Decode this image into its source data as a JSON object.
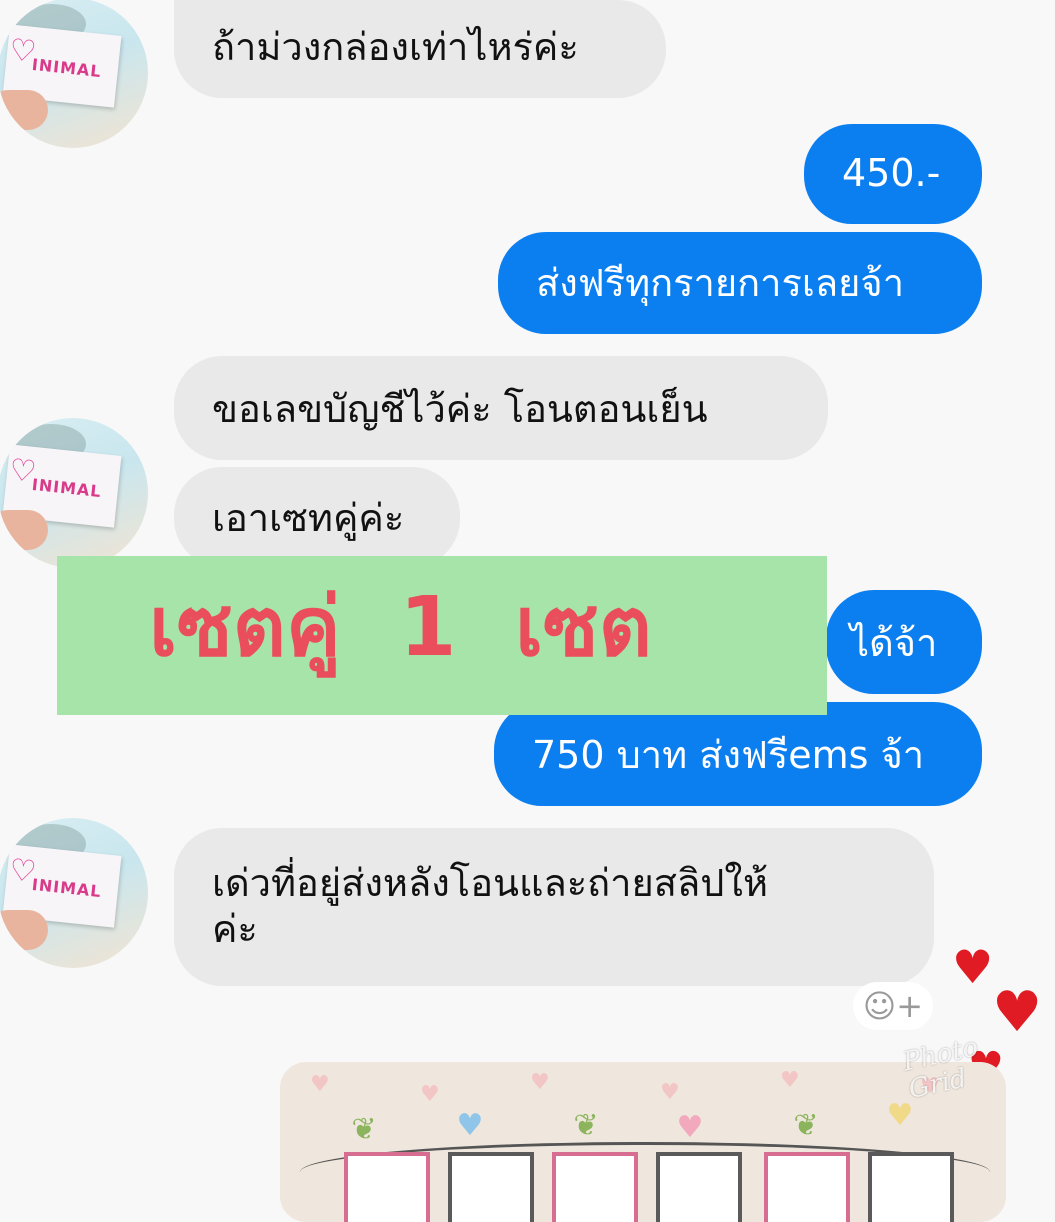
{
  "messages": [
    {
      "text": "ถ้าม่วงกล่องเท่าไหร่ค่ะ"
    },
    {
      "text": "450.-"
    },
    {
      "text": "ส่งฟรีทุกรายการเลยจ้า"
    },
    {
      "text": "ขอเลขบัญชีไว้ค่ะ โอนตอนเย็น"
    },
    {
      "text": "เอาเซทคู่ค่ะ"
    },
    {
      "text": "ได้จ้า"
    },
    {
      "text": "750 บาท ส่งฟรีems จ้า"
    },
    {
      "text": "เด่วที่อยู่ส่งหลังโอนและถ่ายสลิปให้\nค่ะ"
    }
  ],
  "avatar": {
    "brand": "INIMAL"
  },
  "banner": {
    "text": "เซตคู่ 1 เซต"
  },
  "emoji_button": {
    "icon": "smile-plus-icon",
    "glyph": "☺+"
  },
  "watermark": {
    "text": "Photo Grid"
  },
  "colors": {
    "incoming_bubble": "#e9e9e9",
    "outgoing_bubble": "#0c7ff0",
    "banner_bg": "#a7e4aa",
    "banner_text": "#ea4d5c"
  }
}
